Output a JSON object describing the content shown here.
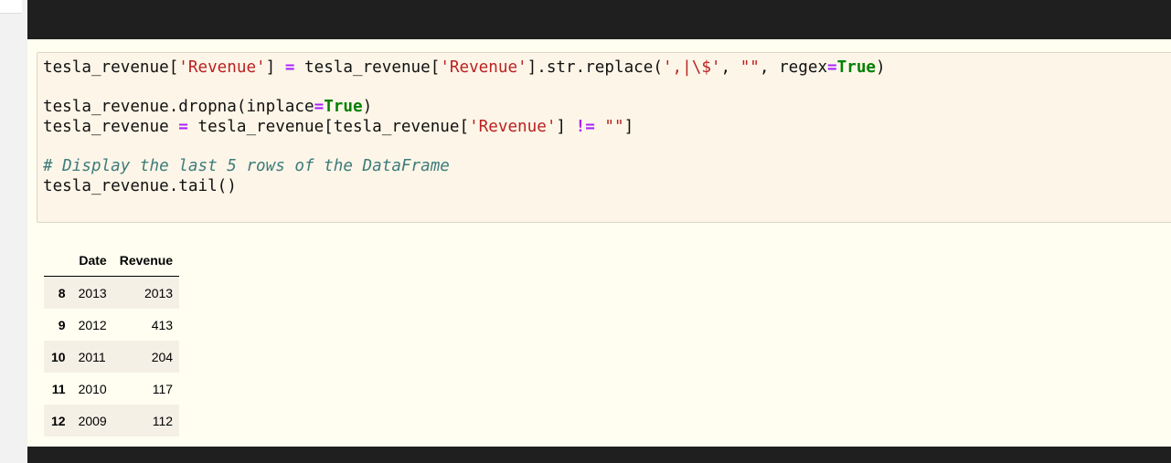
{
  "code_cell": {
    "lines": [
      [
        {
          "t": "tesla_revenue[",
          "c": ""
        },
        {
          "t": "'Revenue'",
          "c": "str"
        },
        {
          "t": "] ",
          "c": ""
        },
        {
          "t": "=",
          "c": "op"
        },
        {
          "t": " tesla_revenue[",
          "c": ""
        },
        {
          "t": "'Revenue'",
          "c": "str"
        },
        {
          "t": "].str.replace(",
          "c": ""
        },
        {
          "t": "',|\\$'",
          "c": "str"
        },
        {
          "t": ", ",
          "c": ""
        },
        {
          "t": "\"\"",
          "c": "str"
        },
        {
          "t": ", regex",
          "c": ""
        },
        {
          "t": "=",
          "c": "op"
        },
        {
          "t": "True",
          "c": "kw"
        },
        {
          "t": ")",
          "c": ""
        }
      ],
      [],
      [
        {
          "t": "tesla_revenue.dropna(inplace",
          "c": ""
        },
        {
          "t": "=",
          "c": "op"
        },
        {
          "t": "True",
          "c": "kw"
        },
        {
          "t": ")",
          "c": ""
        }
      ],
      [
        {
          "t": "tesla_revenue ",
          "c": ""
        },
        {
          "t": "=",
          "c": "op"
        },
        {
          "t": " tesla_revenue[tesla_revenue[",
          "c": ""
        },
        {
          "t": "'Revenue'",
          "c": "str"
        },
        {
          "t": "] ",
          "c": ""
        },
        {
          "t": "!=",
          "c": "op"
        },
        {
          "t": " ",
          "c": ""
        },
        {
          "t": "\"\"",
          "c": "str"
        },
        {
          "t": "]",
          "c": ""
        }
      ],
      [],
      [
        {
          "t": "# Display the last 5 rows of the DataFrame",
          "c": "comment"
        }
      ],
      [
        {
          "t": "tesla_revenue.tail()",
          "c": ""
        }
      ]
    ]
  },
  "output_table": {
    "columns": [
      "Date",
      "Revenue"
    ],
    "rows": [
      {
        "index": "8",
        "date": "2013",
        "revenue": "2013"
      },
      {
        "index": "9",
        "date": "2012",
        "revenue": "413"
      },
      {
        "index": "10",
        "date": "2011",
        "revenue": "204"
      },
      {
        "index": "11",
        "date": "2010",
        "revenue": "117"
      },
      {
        "index": "12",
        "date": "2009",
        "revenue": "112"
      }
    ]
  },
  "colors": {
    "string": "#ba2121",
    "operator": "#aa22ff",
    "keyword": "#008000",
    "comment": "#3d7b7b",
    "cell_background": "#fdf6e8",
    "output_background": "#fffef0",
    "chrome_dark": "#1f1f1f"
  }
}
